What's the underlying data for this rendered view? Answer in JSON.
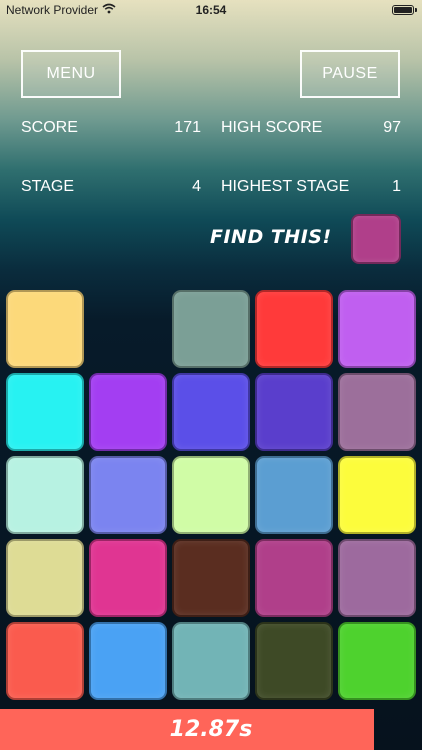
{
  "status_bar": {
    "carrier": "Network Provider",
    "time": "16:54"
  },
  "buttons": {
    "menu": "MENU",
    "pause": "PAUSE"
  },
  "stats": {
    "score_label": "SCORE",
    "score_value": "171",
    "high_score_label": "HIGH SCORE",
    "high_score_value": "97",
    "stage_label": "STAGE",
    "stage_value": "4",
    "highest_stage_label": "HIGHEST STAGE",
    "highest_stage_value": "1"
  },
  "find": {
    "label": "FIND THIS!",
    "target_color": "#b03f8a"
  },
  "grid": {
    "rows": 5,
    "cols": 5,
    "tiles": [
      "#fcd97a",
      null,
      "#7b9f96",
      "#ff3a3a",
      "#c05ff0",
      "#27f2f2",
      "#a33ef2",
      "#5b4fe8",
      "#5a3ecc",
      "#9c6f9b",
      "#b7f2e2",
      "#7b84f0",
      "#d0fca6",
      "#5b9ed2",
      "#fcfc3c",
      "#dedc95",
      "#e03592",
      "#5a2d20",
      "#b03f8a",
      "#9d6a9e",
      "#fa5b4e",
      "#4aa2f4",
      "#72b4b6",
      "#3e4a26",
      "#4ed22e"
    ]
  },
  "timer": {
    "label": "12.87s",
    "progress": 0.886,
    "color": "#ff6559"
  }
}
